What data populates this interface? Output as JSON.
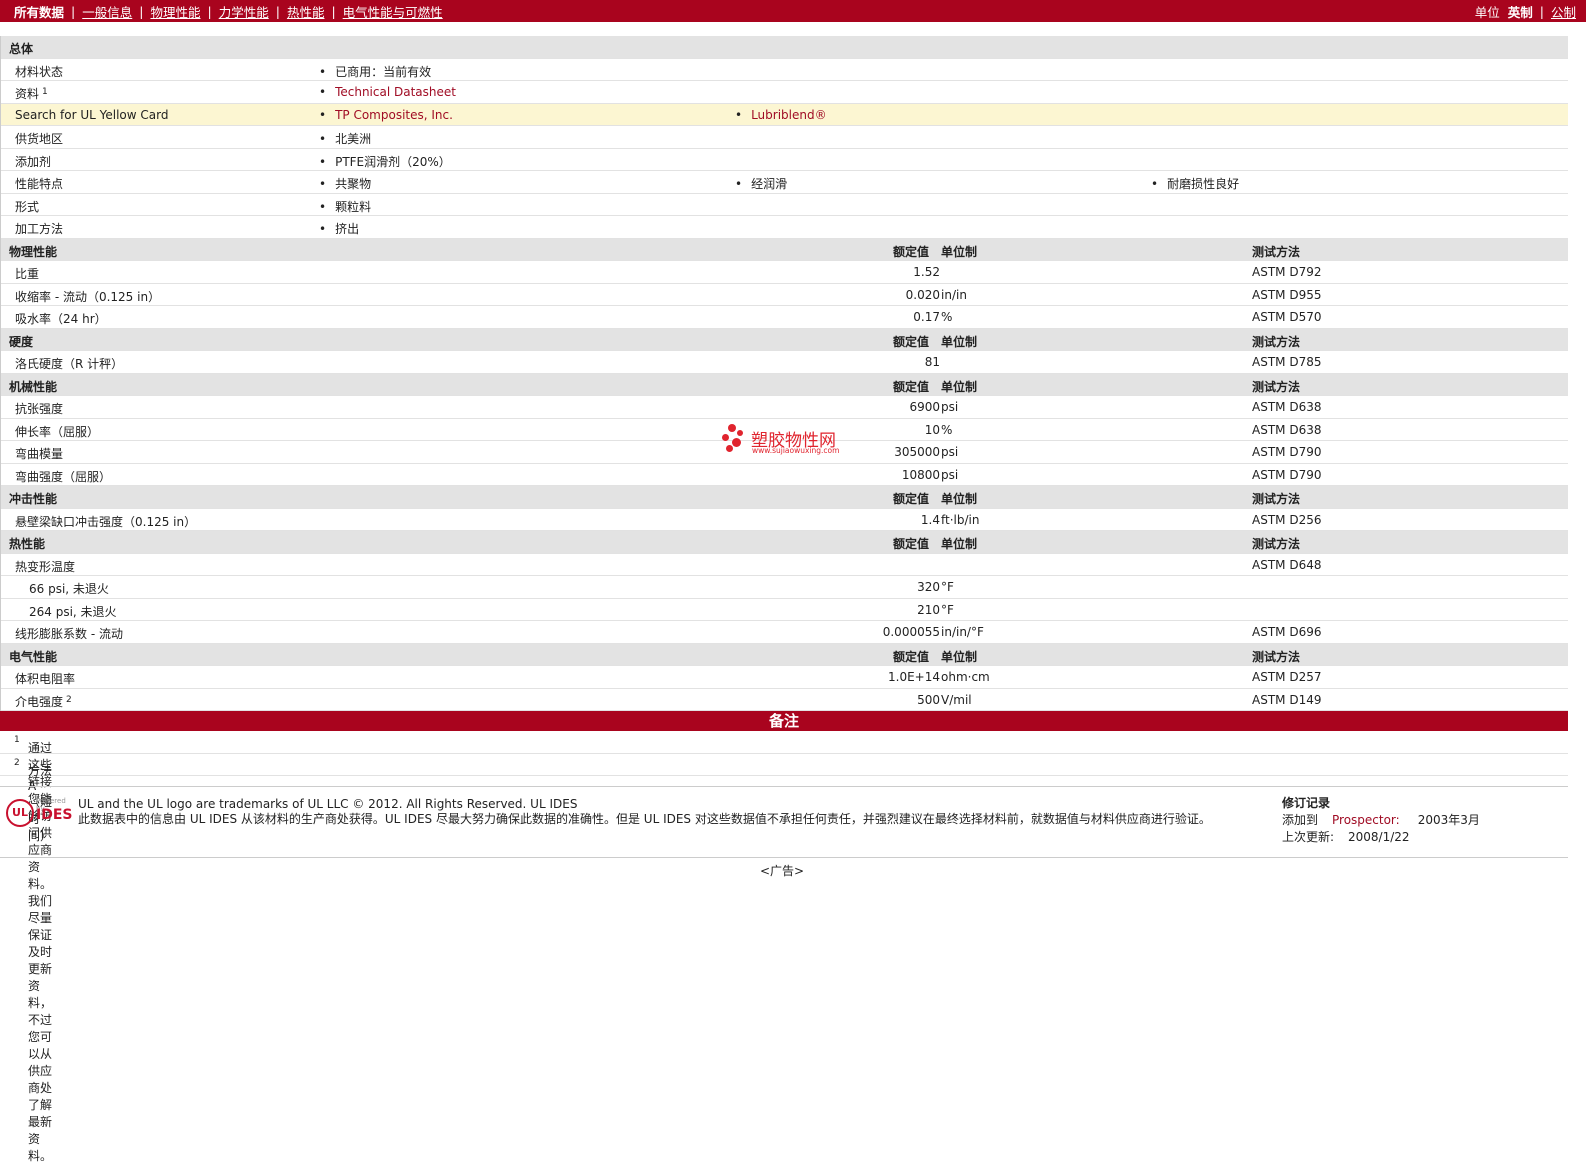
{
  "nav": {
    "items": [
      "所有数据",
      "一般信息",
      "物理性能",
      "力学性能",
      "热性能",
      "电气性能与可燃性"
    ],
    "unit_label": "单位",
    "unit_imperial": "英制",
    "unit_metric": "公制"
  },
  "general": {
    "title": "总体",
    "rows": [
      {
        "label": "材料状态",
        "values": [
          "已商用：当前有效"
        ]
      },
      {
        "label": "资料",
        "sup": "1",
        "values": [
          "Technical Datasheet"
        ]
      },
      {
        "label": "Search for UL Yellow Card",
        "values": [
          "TP Composites, Inc.",
          "Lubriblend®"
        ]
      },
      {
        "label": "供货地区",
        "values": [
          "北美洲"
        ]
      },
      {
        "label": "添加剂",
        "values": [
          "PTFE润滑剂（20%）"
        ]
      },
      {
        "label": "性能特点",
        "values": [
          "共聚物",
          "经润滑",
          "耐磨损性良好"
        ]
      },
      {
        "label": "形式",
        "values": [
          "颗粒料"
        ]
      },
      {
        "label": "加工方法",
        "values": [
          "挤出"
        ]
      }
    ]
  },
  "headers": {
    "value": "额定值",
    "unit": "单位制",
    "test": "测试方法"
  },
  "sections": [
    {
      "title": "物理性能",
      "rows": [
        {
          "label": "比重",
          "value": "1.52",
          "unit": "",
          "test": "ASTM D792"
        },
        {
          "label": "收缩率  - 流动（0.125 in）",
          "value": "0.020",
          "unit": "in/in",
          "test": "ASTM D955"
        },
        {
          "label": "吸水率（24 hr）",
          "value": "0.17",
          "unit": "%",
          "test": "ASTM D570"
        }
      ]
    },
    {
      "title": "硬度",
      "rows": [
        {
          "label": "洛氏硬度（R 计秤）",
          "value": "81",
          "unit": "",
          "test": "ASTM D785"
        }
      ]
    },
    {
      "title": "机械性能",
      "rows": [
        {
          "label": "抗张强度",
          "value": "6900",
          "unit": "psi",
          "test": "ASTM D638"
        },
        {
          "label": "伸长率（屈服）",
          "value": "10",
          "unit": "%",
          "test": "ASTM D638"
        },
        {
          "label": "弯曲模量",
          "value": "305000",
          "unit": "psi",
          "test": "ASTM D790"
        },
        {
          "label": "弯曲强度（屈服）",
          "value": "10800",
          "unit": "psi",
          "test": "ASTM D790"
        }
      ]
    },
    {
      "title": "冲击性能",
      "rows": [
        {
          "label": "悬壁梁缺口冲击强度（0.125 in）",
          "value": "1.4",
          "unit": "ft·lb/in",
          "test": "ASTM D256"
        }
      ]
    },
    {
      "title": "热性能",
      "rows": [
        {
          "label": "热变形温度",
          "value": "",
          "unit": "",
          "test": "ASTM D648"
        },
        {
          "label": "66 psi, 未退火",
          "value": "320",
          "unit": "°F",
          "test": "",
          "indent": true
        },
        {
          "label": "264 psi, 未退火",
          "value": "210",
          "unit": "°F",
          "test": "",
          "indent": true
        },
        {
          "label": "线形膨胀系数  - 流动",
          "value": "0.000055",
          "unit": "in/in/°F",
          "test": "ASTM D696"
        }
      ]
    },
    {
      "title": "电气性能",
      "rows": [
        {
          "label": "体积电阻率",
          "value": "1.0E+14",
          "unit": "ohm·cm",
          "test": "ASTM D257"
        },
        {
          "label": "介电强度",
          "sup": "2",
          "value": "500",
          "unit": "V/mil",
          "test": "ASTM D149"
        }
      ]
    }
  ],
  "notes": {
    "title": "备注",
    "items": [
      {
        "sup": "1",
        "text": "通过这些链接您能够访问供应商资料。我们尽量保证及时更新资料，不过您可以从供应商处了解最新资料。"
      },
      {
        "sup": "2",
        "text": "方法A（短时间）"
      }
    ]
  },
  "footer": {
    "logo_powered": "Powered by",
    "logo_ul": "UL",
    "logo_ides": "IDES",
    "legal_line1": "UL and the UL logo are trademarks of UL LLC © 2012. All Rights Reserved. UL IDES",
    "legal_line2": "此数据表中的信息由 UL IDES 从该材料的生产商处获得。UL IDES 尽最大努力确保此数据的准确性。但是 UL IDES 对这些数据值不承担任何责任，并强烈建议在最终选择材料前，就数据值与材料供应商进行验证。",
    "revision_title": "修订记录",
    "added_label": "添加到",
    "added_source": "Prospector:",
    "added_date": "2003年3月",
    "updated_label": "上次更新:",
    "updated_date": "2008/1/22"
  },
  "ad": "<广告>",
  "watermark": {
    "title": "塑胶物性网",
    "url": "www.sujiaowuxing.com"
  }
}
